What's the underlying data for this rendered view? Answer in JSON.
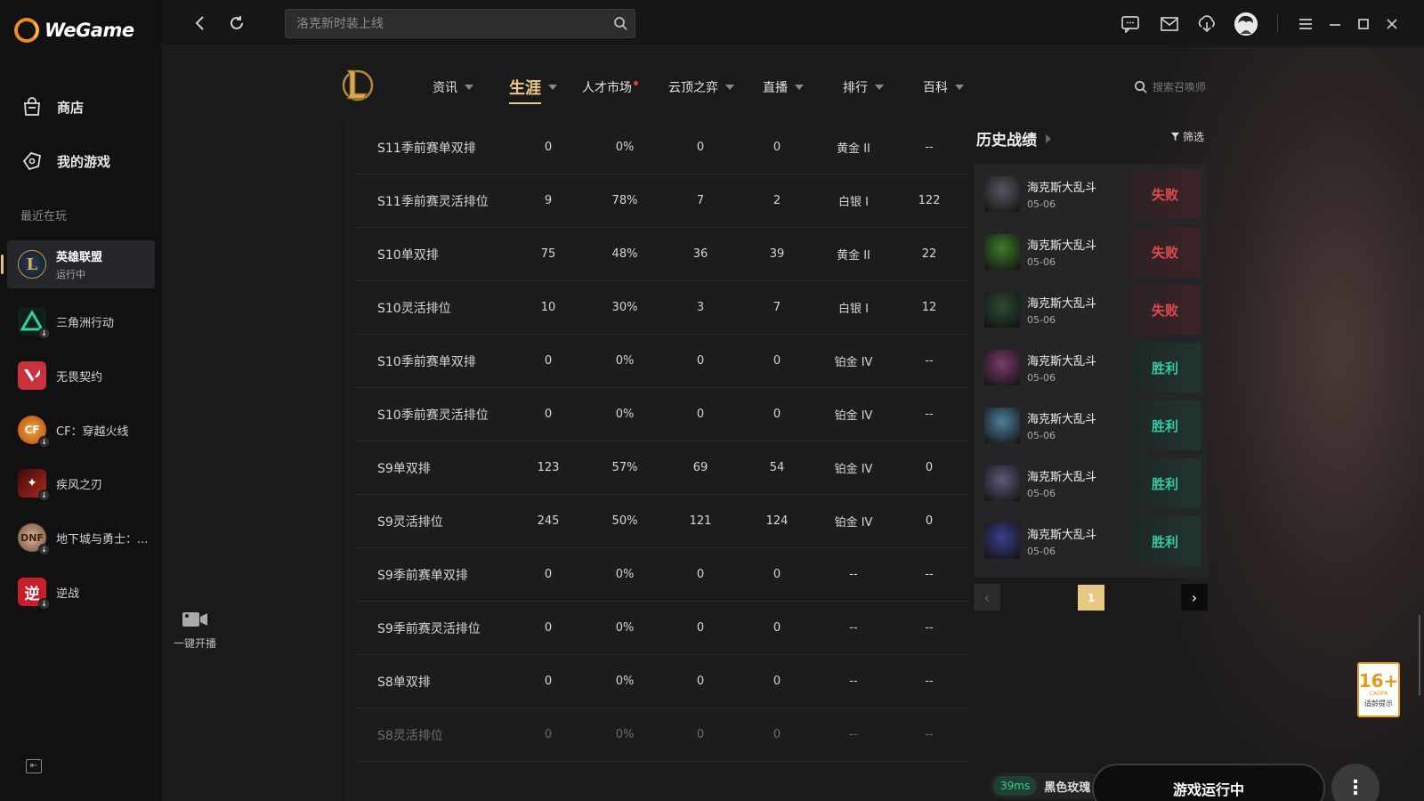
{
  "app": {
    "logo_text": "WeGame"
  },
  "sidebar": {
    "nav": [
      {
        "label": "商店",
        "icon": "store-bag-icon"
      },
      {
        "label": "我的游戏",
        "icon": "gamepad-icon"
      }
    ],
    "recent_label": "最近在玩",
    "games": [
      {
        "name": "英雄联盟",
        "status": "运行中",
        "active": true,
        "color": "#c89b3c"
      },
      {
        "name": "三角洲行动",
        "status": "",
        "color": "#1f6f5a"
      },
      {
        "name": "无畏契约",
        "status": "",
        "color": "#c7323d"
      },
      {
        "name": "CF：穿越火线",
        "status": "",
        "color": "#d76a1c"
      },
      {
        "name": "疾风之刃",
        "status": "",
        "color": "#a0221d"
      },
      {
        "name": "地下城与勇士：...",
        "status": "",
        "color": "#7a5b3e"
      },
      {
        "name": "逆战",
        "status": "",
        "color": "#d02030"
      }
    ]
  },
  "topbar": {
    "search_placeholder": "洛克新时装上线"
  },
  "game_nav": {
    "items": [
      {
        "label": "资讯",
        "caret": true
      },
      {
        "label": "生涯",
        "caret": true,
        "active": true
      },
      {
        "label": "人才市场",
        "caret": false,
        "dot": true
      },
      {
        "label": "云顶之弈",
        "caret": true
      },
      {
        "label": "直播",
        "caret": true
      },
      {
        "label": "排行",
        "caret": true
      },
      {
        "label": "百科",
        "caret": true
      }
    ],
    "summoner_search_placeholder": "搜索召唤师"
  },
  "rank_table": {
    "rows": [
      [
        "S11季前赛单双排",
        "0",
        "0%",
        "0",
        "0",
        "黄金 II",
        "--"
      ],
      [
        "S11季前赛灵活排位",
        "9",
        "78%",
        "7",
        "2",
        "白银 I",
        "122"
      ],
      [
        "S10单双排",
        "75",
        "48%",
        "36",
        "39",
        "黄金 II",
        "22"
      ],
      [
        "S10灵活排位",
        "10",
        "30%",
        "3",
        "7",
        "白银 I",
        "12"
      ],
      [
        "S10季前赛单双排",
        "0",
        "0%",
        "0",
        "0",
        "铂金 IV",
        "--"
      ],
      [
        "S10季前赛灵活排位",
        "0",
        "0%",
        "0",
        "0",
        "铂金 IV",
        "--"
      ],
      [
        "S9单双排",
        "123",
        "57%",
        "69",
        "54",
        "铂金 IV",
        "0"
      ],
      [
        "S9灵活排位",
        "245",
        "50%",
        "121",
        "124",
        "铂金 IV",
        "0"
      ],
      [
        "S9季前赛单双排",
        "0",
        "0%",
        "0",
        "0",
        "--",
        "--"
      ],
      [
        "S9季前赛灵活排位",
        "0",
        "0%",
        "0",
        "0",
        "--",
        "--"
      ],
      [
        "S8单双排",
        "0",
        "0%",
        "0",
        "0",
        "--",
        "--"
      ],
      [
        "S8灵活排位",
        "0",
        "0%",
        "0",
        "0",
        "--",
        "--"
      ]
    ]
  },
  "history": {
    "title": "历史战绩",
    "filter_label": "筛选",
    "matches": [
      {
        "mode": "海克斯大乱斗",
        "date": "05-06",
        "result": "失败",
        "win": false,
        "champ_color": "#5a5560"
      },
      {
        "mode": "海克斯大乱斗",
        "date": "05-06",
        "result": "失败",
        "win": false,
        "champ_color": "#3f7a2a"
      },
      {
        "mode": "海克斯大乱斗",
        "date": "05-06",
        "result": "失败",
        "win": false,
        "champ_color": "#2d4a33"
      },
      {
        "mode": "海克斯大乱斗",
        "date": "05-06",
        "result": "胜利",
        "win": true,
        "champ_color": "#7a3b6a"
      },
      {
        "mode": "海克斯大乱斗",
        "date": "05-06",
        "result": "胜利",
        "win": true,
        "champ_color": "#4d7e9a"
      },
      {
        "mode": "海克斯大乱斗",
        "date": "05-06",
        "result": "胜利",
        "win": true,
        "champ_color": "#5b5a7a"
      },
      {
        "mode": "海克斯大乱斗",
        "date": "05-06",
        "result": "胜利",
        "win": true,
        "champ_color": "#3a3f8a"
      }
    ],
    "page": "1"
  },
  "bottom": {
    "live_label": "一键开播",
    "ping": "39ms",
    "server": "黑色玫瑰",
    "run_label": "游戏运行中",
    "age_rating": "16+",
    "age_sub": "CADPA",
    "age_tip": "适龄提示"
  }
}
